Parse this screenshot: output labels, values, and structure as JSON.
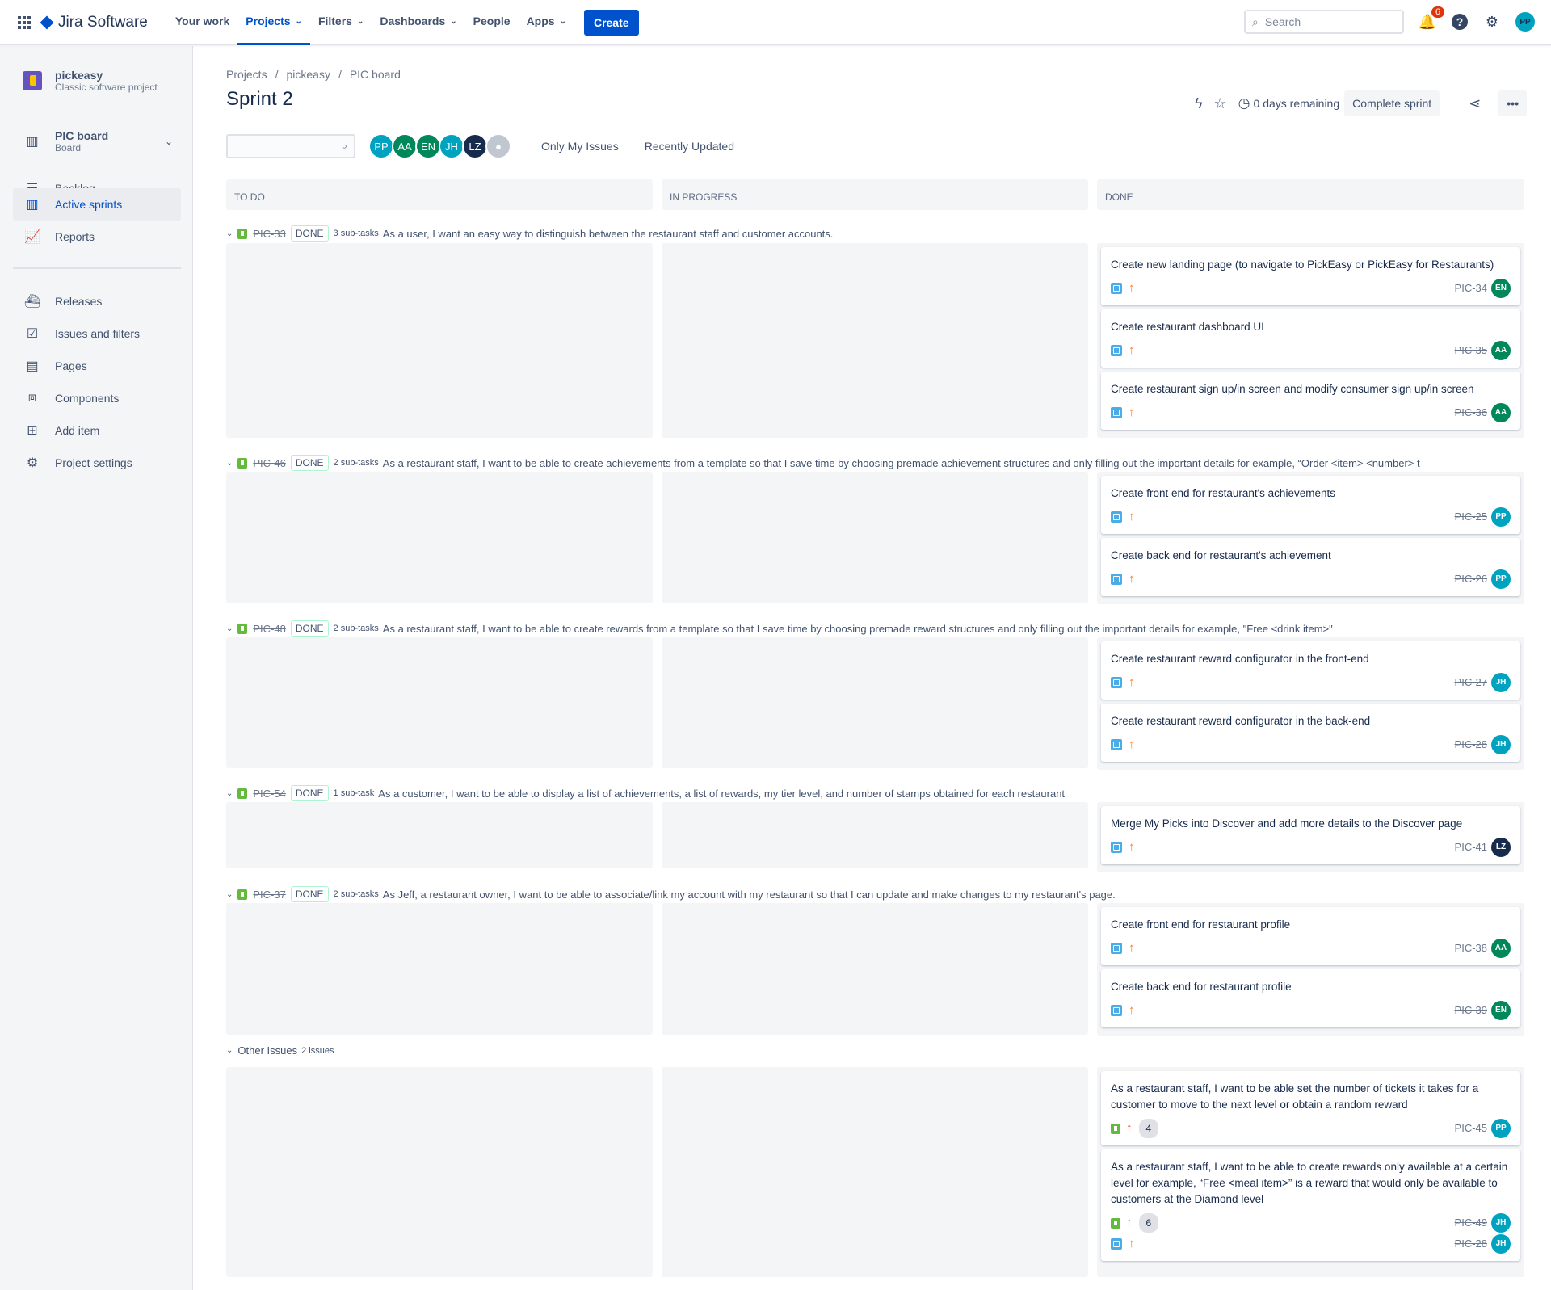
{
  "topnav": {
    "app_name": "Jira Software",
    "items": [
      {
        "label": "Your work"
      },
      {
        "label": "Projects"
      },
      {
        "label": "Filters"
      },
      {
        "label": "Dashboards"
      },
      {
        "label": "People"
      },
      {
        "label": "Apps"
      }
    ],
    "create_label": "Create",
    "search_placeholder": "Search",
    "notification_count": "6",
    "user_initials": "PP"
  },
  "sidebar": {
    "project_name": "pickeasy",
    "project_type": "Classic software project",
    "board_name": "PIC board",
    "board_sub": "Board",
    "items": [
      {
        "label": "Backlog"
      },
      {
        "label": "Active sprints"
      },
      {
        "label": "Reports"
      },
      {
        "label": "Releases"
      },
      {
        "label": "Issues and filters"
      },
      {
        "label": "Pages"
      },
      {
        "label": "Components"
      },
      {
        "label": "Add item"
      },
      {
        "label": "Project settings"
      }
    ]
  },
  "header": {
    "breadcrumb": [
      "Projects",
      "pickeasy",
      "PIC board"
    ],
    "title": "Sprint 2",
    "days_remaining": "0 days remaining",
    "complete_label": "Complete sprint"
  },
  "filters": {
    "avatars": [
      "PP",
      "AA",
      "EN",
      "JH",
      "LZ"
    ],
    "only_my": "Only My Issues",
    "recent": "Recently Updated"
  },
  "columns": [
    "TO DO",
    "IN PROGRESS",
    "DONE"
  ],
  "colors": {
    "PP": "#00a3bf",
    "AA": "#00875a",
    "EN": "#00875a",
    "JH": "#00a3bf",
    "LZ": "#172b4d"
  },
  "lanes": [
    {
      "key": "PIC-33",
      "status": "DONE",
      "subtasks": "3 sub-tasks",
      "summary": "As a user, I want an easy way to distinguish between the restaurant staff and customer accounts.",
      "cards": [
        {
          "title": "Create new landing page (to navigate to PickEasy or PickEasy for Restaurants)",
          "key": "PIC-34",
          "assignee": "EN"
        },
        {
          "title": "Create restaurant dashboard UI",
          "key": "PIC-35",
          "assignee": "AA"
        },
        {
          "title": "Create restaurant sign up/in screen and modify consumer sign up/in screen",
          "key": "PIC-36",
          "assignee": "AA"
        }
      ]
    },
    {
      "key": "PIC-46",
      "status": "DONE",
      "subtasks": "2 sub-tasks",
      "summary": "As a restaurant staff, I want to be able to create achievements from a template so that I save time by choosing premade achievement structures and only filling out the important details for example, “Order <item> <number> t",
      "cards": [
        {
          "title": "Create front end for restaurant's achievements",
          "key": "PIC-25",
          "assignee": "PP"
        },
        {
          "title": "Create back end for restaurant's achievement",
          "key": "PIC-26",
          "assignee": "PP"
        }
      ]
    },
    {
      "key": "PIC-48",
      "status": "DONE",
      "subtasks": "2 sub-tasks",
      "summary": "As a restaurant staff, I want to be able to create rewards from a template so that I save time by choosing premade reward structures and only filling out the important details for example, \"Free <drink item>\"",
      "cards": [
        {
          "title": "Create restaurant reward configurator in the front-end",
          "key": "PIC-27",
          "assignee": "JH"
        },
        {
          "title": "Create restaurant reward configurator in the back-end",
          "key": "PIC-28",
          "assignee": "JH"
        }
      ]
    },
    {
      "key": "PIC-54",
      "status": "DONE",
      "subtasks": "1 sub-task",
      "summary": "As a customer, I want to be able to display a list of achievements, a list of rewards, my tier level, and number of stamps obtained for each restaurant",
      "cards": [
        {
          "title": "Merge My Picks into Discover and add more details to the Discover page",
          "key": "PIC-41",
          "assignee": "LZ"
        }
      ]
    },
    {
      "key": "PIC-37",
      "status": "DONE",
      "subtasks": "2 sub-tasks",
      "summary": "As Jeff, a restaurant owner, I want to be able to associate/link my account with my restaurant so that I can update and make changes to my restaurant's page.",
      "cards": [
        {
          "title": "Create front end for restaurant profile",
          "key": "PIC-38",
          "assignee": "AA"
        },
        {
          "title": "Create back end for restaurant profile",
          "key": "PIC-39",
          "assignee": "EN"
        }
      ]
    }
  ],
  "other": {
    "label": "Other Issues",
    "count": "2 issues",
    "cards": [
      {
        "title": "As a restaurant staff, I want to be able set the number of tickets it takes for a customer to move to the next level or obtain a random reward",
        "key": "PIC-45",
        "assignee": "PP",
        "estimate": "4"
      },
      {
        "title": "As a restaurant staff, I want to be able to create rewards only available at a certain level for example, “Free <meal item>” is a reward that would only be available to customers at the Diamond level",
        "key": "PIC-49",
        "assignee": "JH",
        "estimate": "6",
        "subkey": "PIC-28",
        "subassignee": "JH"
      }
    ]
  }
}
